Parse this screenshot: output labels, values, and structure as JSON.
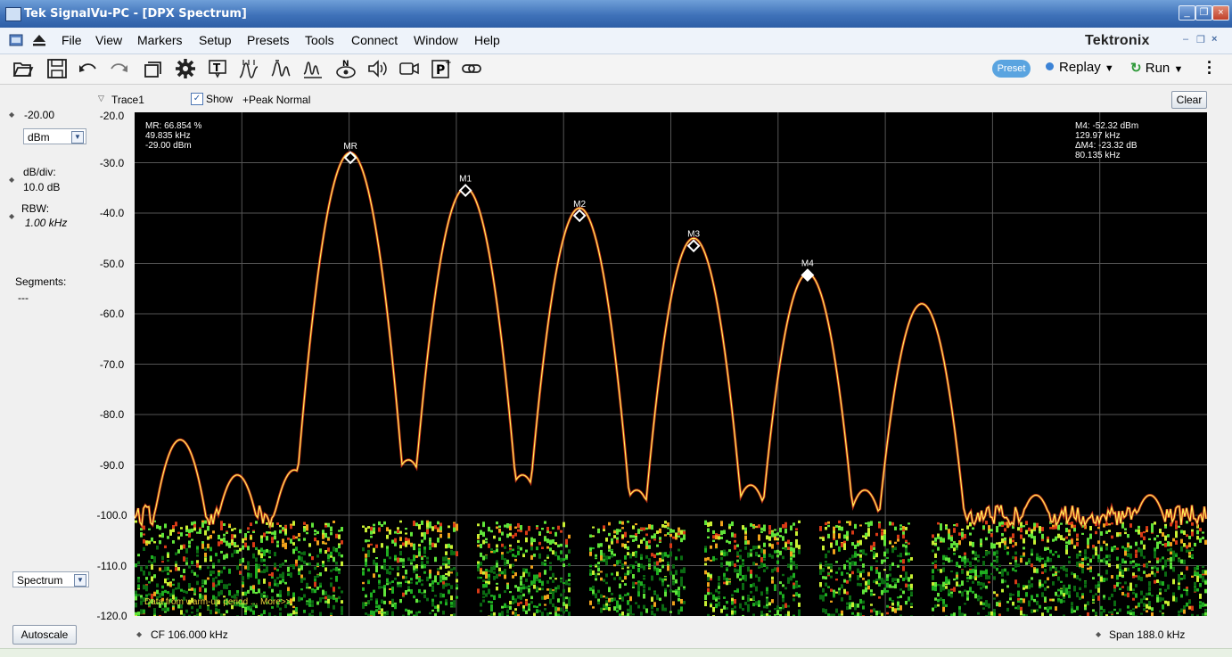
{
  "window": {
    "title": "Tek SignalVu-PC - [DPX Spectrum]"
  },
  "menu": {
    "items": [
      "File",
      "View",
      "Markers",
      "Setup",
      "Presets",
      "Tools",
      "Connect",
      "Window",
      "Help"
    ],
    "brand": "Tektronix"
  },
  "toolbar": {
    "icons": [
      "open-icon",
      "save-icon",
      "undo-icon",
      "redo-icon",
      "windows-icon",
      "settings-gear-icon",
      "trace-icon",
      "markers-icon",
      "peak-icon",
      "spectrum-icon",
      "recorder-icon",
      "audio-icon",
      "video-icon",
      "preset-p-icon",
      "link-icon"
    ],
    "preset_label": "Preset",
    "replay_label": "Replay",
    "run_label": "Run"
  },
  "left_panel": {
    "ref_level": "-20.00",
    "units": "dBm",
    "scale_label": "dB/div:",
    "scale_value": "10.0 dB",
    "rbw_label": "RBW:",
    "rbw_value": "1.00 kHz",
    "segments_label": "Segments:",
    "segments_value": "---",
    "mode": "Spectrum",
    "autoscale_label": "Autoscale"
  },
  "trace_bar": {
    "trace_label": "Trace1",
    "show_label": "Show",
    "detector_label": "+Peak Normal",
    "clear_label": "Clear"
  },
  "y_axis_ticks": [
    "-20.0",
    "-30.0",
    "-40.0",
    "-50.0",
    "-60.0",
    "-70.0",
    "-80.0",
    "-90.0",
    "-100.0",
    "-110.0",
    "-120.0"
  ],
  "readout_left": "MR: 66.854 %\n49.835 kHz\n-29.00 dBm",
  "readout_right": "M4: -52.32 dBm\n129.97 kHz\nΔM4: -23.32 dB\n80.135 kHz",
  "warmup_text": "Data from warm-up period ... More>>",
  "status": {
    "cf": "CF  106.000 kHz",
    "span": "Span  188.0 kHz"
  },
  "chart_data": {
    "type": "line",
    "xlabel": "",
    "ylabel": "",
    "center_frequency_khz": 106.0,
    "span_khz": 188.0,
    "ylim": [
      -120,
      -20
    ],
    "grid": true,
    "peaks": [
      {
        "freq_khz": 20.0,
        "level_dbm": -85
      },
      {
        "freq_khz": 30.0,
        "level_dbm": -92
      },
      {
        "freq_khz": 40.0,
        "level_dbm": -91
      },
      {
        "freq_khz": 49.8,
        "level_dbm": -28
      },
      {
        "freq_khz": 60.0,
        "level_dbm": -89
      },
      {
        "freq_khz": 70.0,
        "level_dbm": -35
      },
      {
        "freq_khz": 80.0,
        "level_dbm": -92
      },
      {
        "freq_khz": 90.0,
        "level_dbm": -39
      },
      {
        "freq_khz": 100.0,
        "level_dbm": -95
      },
      {
        "freq_khz": 110.0,
        "level_dbm": -45
      },
      {
        "freq_khz": 120.0,
        "level_dbm": -94
      },
      {
        "freq_khz": 130.0,
        "level_dbm": -52
      },
      {
        "freq_khz": 140.0,
        "level_dbm": -95
      },
      {
        "freq_khz": 150.0,
        "level_dbm": -58
      },
      {
        "freq_khz": 170.0,
        "level_dbm": -96
      },
      {
        "freq_khz": 190.0,
        "level_dbm": -96
      }
    ],
    "noise_floor_dbm": -100,
    "markers": [
      {
        "label": "MR",
        "freq_khz": 49.835,
        "level_dbm": -29.0
      },
      {
        "label": "M1",
        "freq_khz": 70.0,
        "level_dbm": -35.5
      },
      {
        "label": "M2",
        "freq_khz": 90.0,
        "level_dbm": -40.5
      },
      {
        "label": "M3",
        "freq_khz": 110.0,
        "level_dbm": -46.5
      },
      {
        "label": "M4",
        "freq_khz": 129.97,
        "level_dbm": -52.32
      }
    ]
  }
}
